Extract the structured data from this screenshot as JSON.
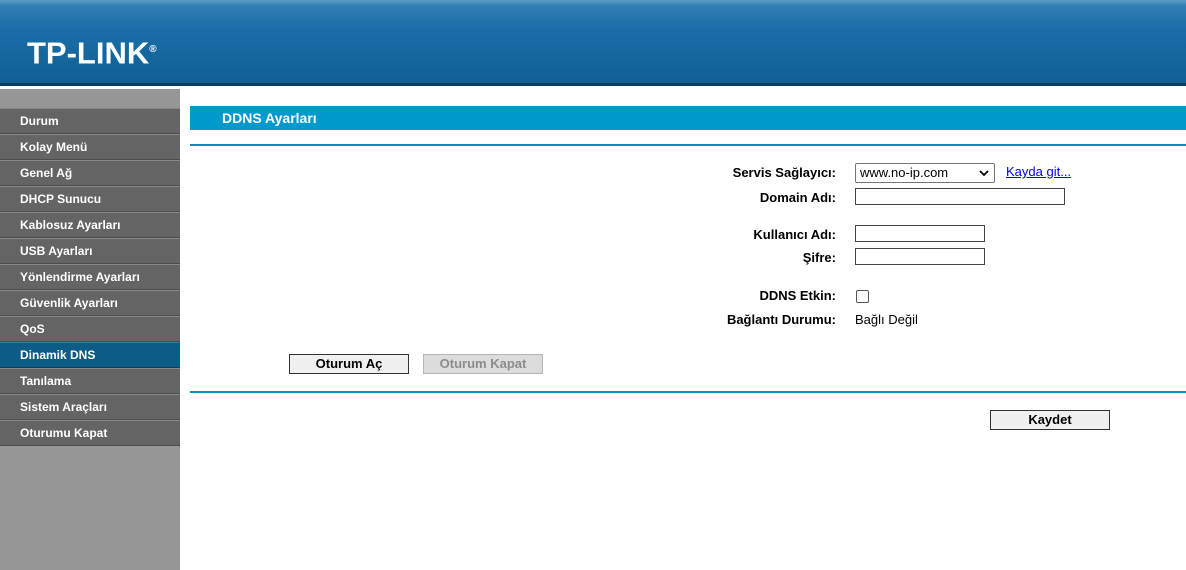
{
  "header": {
    "logo_text": "TP-LINK",
    "logo_mark": "®"
  },
  "sidebar": {
    "items": [
      {
        "label": "Durum"
      },
      {
        "label": "Kolay Menü"
      },
      {
        "label": "Genel Ağ"
      },
      {
        "label": "DHCP Sunucu"
      },
      {
        "label": "Kablosuz Ayarları"
      },
      {
        "label": "USB Ayarları"
      },
      {
        "label": "Yönlendirme Ayarları"
      },
      {
        "label": "Güvenlik Ayarları"
      },
      {
        "label": "QoS"
      },
      {
        "label": "Dinamik DNS",
        "active": true
      },
      {
        "label": "Tanılama"
      },
      {
        "label": "Sistem Araçları"
      },
      {
        "label": "Oturumu Kapat"
      }
    ]
  },
  "page": {
    "title": "DDNS Ayarları"
  },
  "form": {
    "service_provider_label": "Servis Sağlayıcı:",
    "service_provider_value": "www.no-ip.com",
    "register_link": "Kayda git...",
    "domain_label": "Domain Adı:",
    "domain_value": "",
    "username_label": "Kullanıcı Adı:",
    "username_value": "",
    "password_label": "Şifre:",
    "password_value": "",
    "ddns_enabled_label": "DDNS Etkin:",
    "ddns_enabled": false,
    "connection_status_label": "Bağlantı Durumu:",
    "connection_status_value": "Bağlı Değil"
  },
  "buttons": {
    "login": "Oturum Aç",
    "logout": "Oturum Kapat",
    "save": "Kaydet"
  },
  "colors": {
    "header_blue": "#1a6da6",
    "title_bar": "#0099cc",
    "nav_active": "#0d5c86",
    "nav_default": "#646464",
    "sidebar_bg": "#969696"
  }
}
